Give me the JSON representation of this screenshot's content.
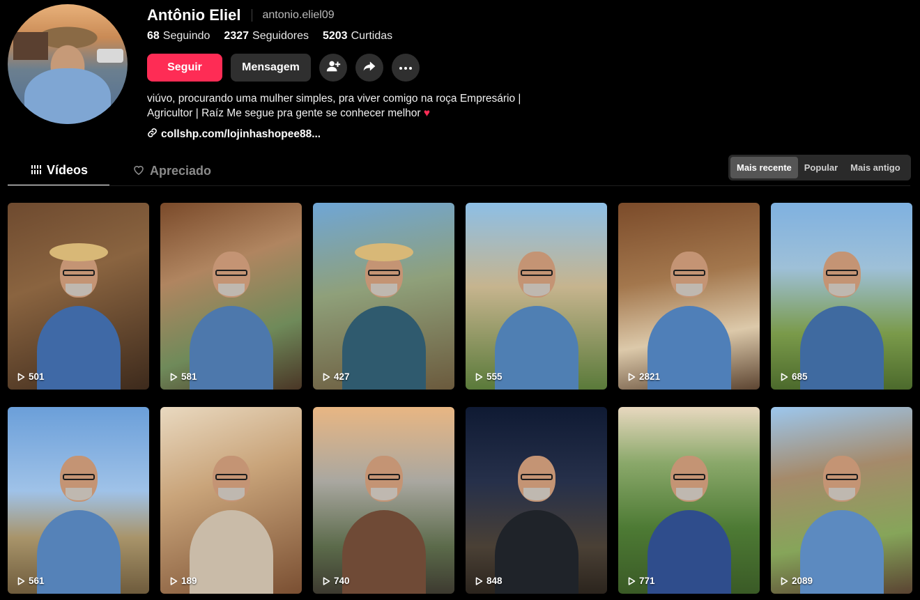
{
  "profile": {
    "display_name": "Antônio Eliel",
    "handle": "antonio.eliel09",
    "stats": {
      "following_count": "68",
      "following_label": "Seguindo",
      "followers_count": "2327",
      "followers_label": "Seguidores",
      "likes_count": "5203",
      "likes_label": "Curtidas"
    },
    "bio_line1": "viúvo, procurando uma mulher simples, pra viver comigo na roça Empresário |",
    "bio_line2": "Agricultor | Raíz Me segue pra gente se conhecer melhor",
    "link": "collshp.com/lojinhashopee88..."
  },
  "actions": {
    "follow_label": "Seguir",
    "message_label": "Mensagem"
  },
  "tabs": [
    {
      "label": "Vídeos",
      "icon": "grid-bars-icon"
    },
    {
      "label": "Apreciado",
      "icon": "heart-outline-icon"
    }
  ],
  "sort": {
    "options": [
      "Mais recente",
      "Popular",
      "Mais antigo"
    ],
    "selected": "Mais recente"
  },
  "colors": {
    "accent": "#fe2c55",
    "background": "#000000",
    "button_dark": "#2f2f2f"
  },
  "videos": [
    {
      "views": "501",
      "bg": "linear-gradient(160deg,#6e4a2f 0%,#8a6440 40%,#3d2a1c 100%)",
      "shirt": "#3f69a6",
      "hat": true
    },
    {
      "views": "581",
      "bg": "linear-gradient(160deg,#7a4a2a 0%,#b08560 35%,#6f8a5a 70%,#4a3626 100%)",
      "shirt": "#4d78ac",
      "hat": false
    },
    {
      "views": "427",
      "bg": "linear-gradient(170deg,#6fa6d6 0%,#8fa07a 45%,#6b5a3d 100%)",
      "shirt": "#2f5a6e",
      "hat": true
    },
    {
      "views": "555",
      "bg": "linear-gradient(180deg,#8dbfe6 0%,#c6b48e 45%,#5a7a3a 100%)",
      "shirt": "#4f7fb3",
      "hat": false
    },
    {
      "views": "2821",
      "bg": "linear-gradient(170deg,#7b4b2a 0%,#a3774d 40%,#dcc9aa 70%,#5d4532 100%)",
      "shirt": "#4f7fb8",
      "hat": false
    },
    {
      "views": "685",
      "bg": "linear-gradient(180deg,#7fb1e0 0%,#9ec0d8 35%,#7a9a4a 70%,#4c6a2c 100%)",
      "shirt": "#3f6aa0",
      "hat": false
    },
    {
      "views": "561",
      "bg": "linear-gradient(180deg,#6b9fd9 0%,#9fc2e8 45%,#a8946a 70%,#6e5b3c 100%)",
      "shirt": "#5582b8",
      "hat": false
    },
    {
      "views": "189",
      "bg": "linear-gradient(160deg,#e9d9c0 0%,#c9a47a 40%,#7a4f32 100%)",
      "shirt": "#c9bba8",
      "hat": false
    },
    {
      "views": "740",
      "bg": "linear-gradient(180deg,#e8b683 0%,#a9a7a0 40%,#5b6a4a 75%,#3d3a30 100%)",
      "shirt": "#6f4a36",
      "hat": false
    },
    {
      "views": "848",
      "bg": "linear-gradient(180deg,#0f1a33 0%,#26304a 40%,#4a4035 75%,#2b241d 100%)",
      "shirt": "#1f2329",
      "hat": false
    },
    {
      "views": "771",
      "bg": "linear-gradient(180deg,#e8d8bf 0%,#8aa86a 30%,#4d7a34 65%,#3a5a26 100%)",
      "shirt": "#2f4d8c",
      "hat": false
    },
    {
      "views": "2089",
      "bg": "linear-gradient(170deg,#9cc7ee 0%,#a58a6a 35%,#86a55a 70%,#5a4332 100%)",
      "shirt": "#5c8ac0",
      "hat": false
    }
  ]
}
